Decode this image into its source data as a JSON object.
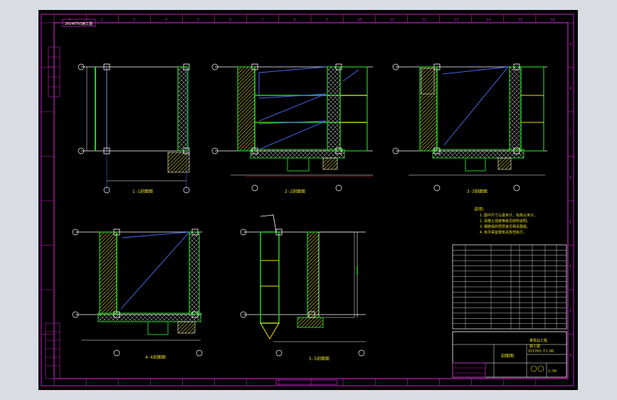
{
  "header_label": "20140703施工图",
  "colors": {
    "frame": "#c020c0",
    "outline": "#ffffff",
    "wall": "#e8e020",
    "concrete": "#20d020",
    "hatch": "#d8d8d8",
    "leader": "#5070ff",
    "red": "#ff3030"
  },
  "section_titles": [
    "1-1剖面图",
    "2-2剖面图",
    "3-3剖面图",
    "4-4剖面图",
    "5-5剖面图"
  ],
  "notes_title": "说明：",
  "notes": [
    "1.图中尺寸以毫米计，标高以米计。",
    "2.混凝土强度等级见结构说明。",
    "3.钢筋保护层厚度见相关图纸。",
    "4.未尽事宜按有关规范执行。"
  ],
  "title_block": {
    "drawing_name": "剖面图",
    "project": "某泵站工程",
    "stage": "施工图",
    "drawing_no": "SY1703-TJ-06",
    "scale": "1:50"
  },
  "frame_numbers_top": [
    "1",
    "2",
    "3",
    "4",
    "5",
    "6",
    "7",
    "8",
    "9",
    "10",
    "11",
    "12",
    "13",
    "14",
    "15",
    "16"
  ],
  "frame_letters_side": [
    "A",
    "B",
    "C",
    "D",
    "E",
    "F",
    "G",
    "H"
  ]
}
